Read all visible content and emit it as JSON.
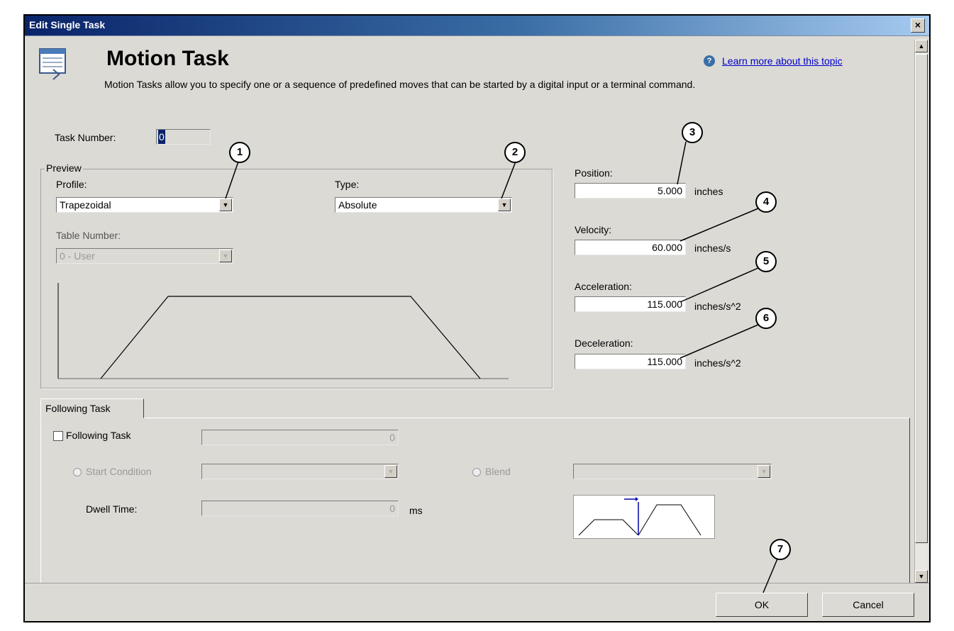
{
  "window": {
    "title": "Edit Single Task",
    "close_glyph": "×"
  },
  "header": {
    "title": "Motion Task",
    "description": "Motion Tasks allow you to specify one or a sequence of predefined moves that can be started by a digital input or a terminal command.",
    "help_link": "Learn more about this topic",
    "help_icon": "?"
  },
  "task_number": {
    "label": "Task Number:",
    "value": "0"
  },
  "preview": {
    "group_label": "Preview",
    "profile_label": "Profile:",
    "profile_value": "Trapezoidal",
    "type_label": "Type:",
    "type_value": "Absolute",
    "table_number_label": "Table Number:",
    "table_number_value": "0 - User"
  },
  "params": {
    "position": {
      "label": "Position:",
      "value": "5.000",
      "unit": "inches"
    },
    "velocity": {
      "label": "Velocity:",
      "value": "60.000",
      "unit": "inches/s"
    },
    "acceleration": {
      "label": "Acceleration:",
      "value": "115.000",
      "unit": "inches/s^2"
    },
    "deceleration": {
      "label": "Deceleration:",
      "value": "115.000",
      "unit": "inches/s^2"
    }
  },
  "following": {
    "tab_label": "Following Task",
    "checkbox_label": "Following Task",
    "checked": false,
    "task_value": "0",
    "start_condition_label": "Start Condition",
    "blend_label": "Blend",
    "dwell_label": "Dwell Time:",
    "dwell_value": "0",
    "dwell_unit": "ms"
  },
  "buttons": {
    "ok": "OK",
    "cancel": "Cancel"
  },
  "callouts": [
    "1",
    "2",
    "3",
    "4",
    "5",
    "6",
    "7"
  ],
  "colors": {
    "titlebar_start": "#0a246a",
    "titlebar_end": "#a6caf0",
    "dialog_bg": "#dcdad5",
    "link": "#0000cc"
  },
  "icons": {
    "task_icon": "table-arrow-icon",
    "help": "help-circle-icon",
    "dropdown": "chevron-down-icon"
  }
}
